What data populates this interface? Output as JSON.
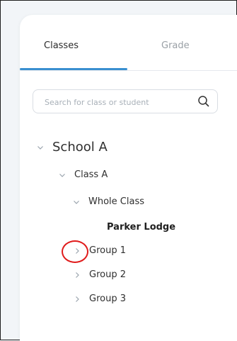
{
  "tabs": {
    "classes_label": "Classes",
    "grade_label": "Grade"
  },
  "search": {
    "placeholder": "Search for class or student",
    "value": ""
  },
  "tree": {
    "school": "School A",
    "class": "Class A",
    "whole_class": "Whole Class",
    "student": "Parker Lodge",
    "groups": [
      "Group 1",
      "Group 2",
      "Group 3"
    ]
  },
  "icons": {
    "search": "search-icon",
    "expanded": "chevron-down-icon",
    "collapsed": "chevron-right-icon"
  },
  "colors": {
    "accent": "#3a8fd0",
    "highlight": "#e01b1b"
  }
}
